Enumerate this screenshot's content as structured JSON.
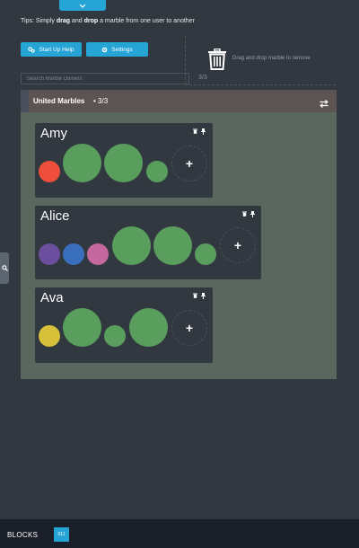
{
  "tips": {
    "prefix": "Tips: Simply ",
    "drag": "drag",
    "and": " and ",
    "drop": "drop",
    "suffix": " a marble from one user to another"
  },
  "toolbar": {
    "startup_help_label": "Start Up Help",
    "settings_label": "Settings"
  },
  "search": {
    "placeholder": "Search Marble Owners",
    "count": "3/3"
  },
  "dropzone": {
    "text": "Drag and drop marble to remove"
  },
  "panel": {
    "title": "United Marbles",
    "count": " •  3/3"
  },
  "users": [
    {
      "name": "Amy",
      "marbles": [
        {
          "color": "#ef4e3d",
          "size": "small"
        },
        {
          "color": "#5a9e5e",
          "size": "large"
        },
        {
          "color": "#5a9e5e",
          "size": "large"
        },
        {
          "color": "#5a9e5e",
          "size": "small"
        }
      ]
    },
    {
      "name": "Alice",
      "marbles": [
        {
          "color": "#6b4f9e",
          "size": "small"
        },
        {
          "color": "#3a6fbd",
          "size": "small"
        },
        {
          "color": "#c668a0",
          "size": "small"
        },
        {
          "color": "#5a9e5e",
          "size": "large"
        },
        {
          "color": "#5a9e5e",
          "size": "large"
        },
        {
          "color": "#5a9e5e",
          "size": "small"
        }
      ]
    },
    {
      "name": "Ava",
      "marbles": [
        {
          "color": "#d7c03a",
          "size": "small"
        },
        {
          "color": "#5a9e5e",
          "size": "large"
        },
        {
          "color": "#5a9e5e",
          "size": "small"
        },
        {
          "color": "#5a9e5e",
          "size": "large"
        }
      ]
    }
  ],
  "footer": {
    "label": "BLOCKS",
    "badge": "011"
  },
  "colors": {
    "accent": "#27a4d6",
    "background": "#323840",
    "panel": "#59675f",
    "panel_header": "#5c5452",
    "marble_green": "#5a9e5e"
  },
  "icons": [
    "chevron-down-icon",
    "gears-icon",
    "gear-icon",
    "trash-icon",
    "swap-icon",
    "delete-icon",
    "pin-icon",
    "plus-icon",
    "search-icon"
  ]
}
